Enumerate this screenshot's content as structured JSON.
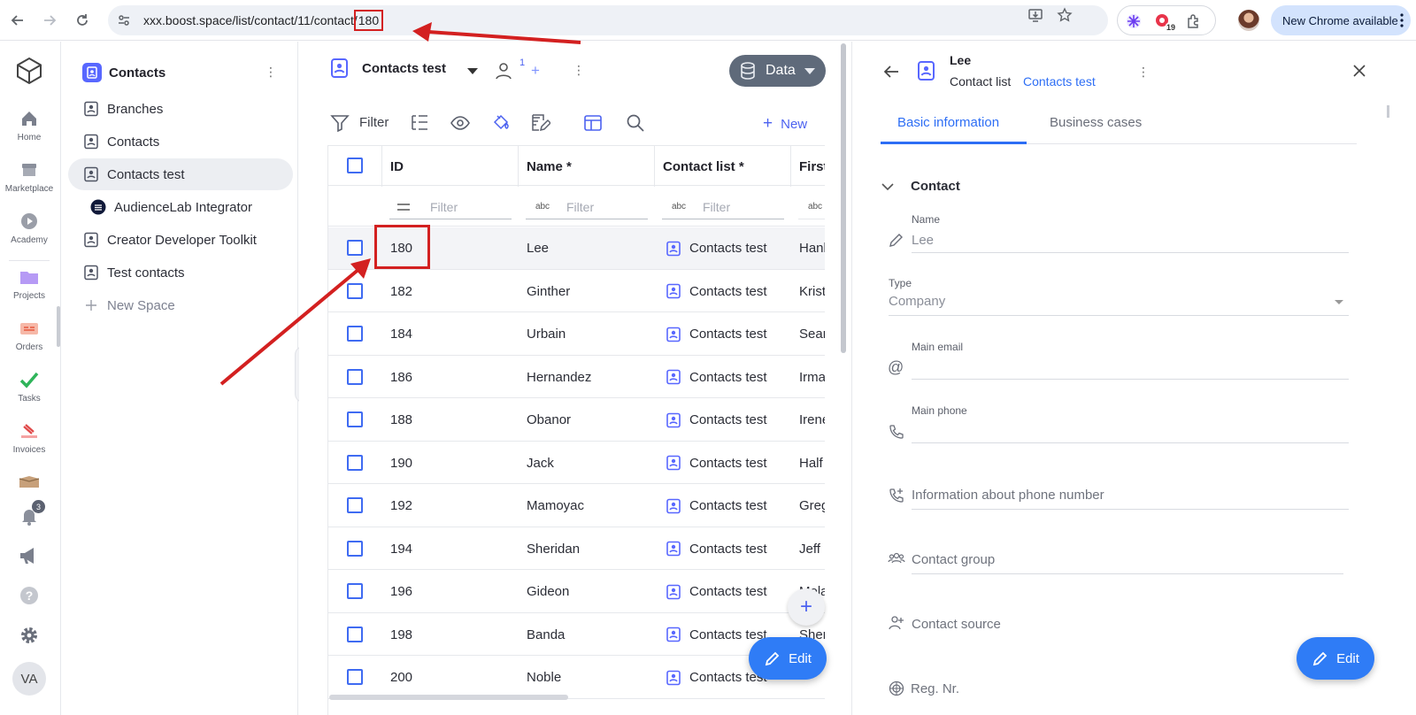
{
  "browser": {
    "url_prefix": "xxx.boost.space/list/contact/11/contact/",
    "url_id": "180",
    "extension_badge": "19",
    "update_label": "New Chrome available"
  },
  "rail": {
    "items": [
      {
        "label": "Home",
        "icon": "home-icon"
      },
      {
        "label": "Marketplace",
        "icon": "store-icon"
      },
      {
        "label": "Academy",
        "icon": "play-icon"
      },
      {
        "label": "Projects",
        "icon": "folder-icon"
      },
      {
        "label": "Orders",
        "icon": "orders-icon"
      },
      {
        "label": "Tasks",
        "icon": "check-icon"
      },
      {
        "label": "Invoices",
        "icon": "invoice-icon"
      }
    ],
    "notifications_count": "3",
    "avatar_initials": "VA"
  },
  "spaces": {
    "title": "Contacts",
    "items": [
      {
        "label": "Branches"
      },
      {
        "label": "Contacts"
      },
      {
        "label": "Contacts test",
        "active": true
      },
      {
        "label": "AudienceLab Integrator"
      },
      {
        "label": "Creator Developer Toolkit"
      },
      {
        "label": "Test contacts"
      }
    ],
    "new_space": "New Space"
  },
  "main": {
    "list_title": "Contacts test",
    "member_count": "1",
    "data_button": "Data",
    "toolbar": {
      "filter_label": "Filter",
      "new_label": "New"
    },
    "columns": [
      "ID",
      "Name *",
      "Contact list *",
      "First"
    ],
    "filter_placeholder": "Filter",
    "filter_text_icon": "abc",
    "rows": [
      {
        "id": "180",
        "name": "Lee",
        "list": "Contacts test",
        "first": "Hank"
      },
      {
        "id": "182",
        "name": "Ginther",
        "list": "Contacts test",
        "first": "Kristy"
      },
      {
        "id": "184",
        "name": "Urbain",
        "list": "Contacts test",
        "first": "Sean"
      },
      {
        "id": "186",
        "name": "Hernandez",
        "list": "Contacts test",
        "first": "Irma"
      },
      {
        "id": "188",
        "name": "Obanor",
        "list": "Contacts test",
        "first": "Irene"
      },
      {
        "id": "190",
        "name": "Jack",
        "list": "Contacts test",
        "first": "Half"
      },
      {
        "id": "192",
        "name": "Mamoyac",
        "list": "Contacts test",
        "first": "Greg"
      },
      {
        "id": "194",
        "name": "Sheridan",
        "list": "Contacts test",
        "first": "Jeff"
      },
      {
        "id": "196",
        "name": "Gideon",
        "list": "Contacts test",
        "first": "Mela"
      },
      {
        "id": "198",
        "name": "Banda",
        "list": "Contacts test",
        "first": "Sher"
      },
      {
        "id": "200",
        "name": "Noble",
        "list": "Contacts test",
        "first": ""
      }
    ],
    "edit_label": "Edit"
  },
  "detail": {
    "name": "Lee",
    "list_label": "Contact list",
    "list_link": "Contacts test",
    "tabs": [
      "Basic information",
      "Business cases"
    ],
    "section": "Contact",
    "fields": {
      "name_label": "Name",
      "name_value": "Lee",
      "type_label": "Type",
      "type_value": "Company",
      "email_label": "Main email",
      "phone_label": "Main phone",
      "phone_info": "Information about phone number",
      "contact_group": "Contact group",
      "contact_source": "Contact source",
      "reg_nr": "Reg. Nr."
    },
    "edit_label": "Edit"
  },
  "colors": {
    "accent": "#4c62f0",
    "link": "#2d6ef5",
    "annotation_red": "#d32020",
    "edit_button": "#2f7cf6"
  }
}
